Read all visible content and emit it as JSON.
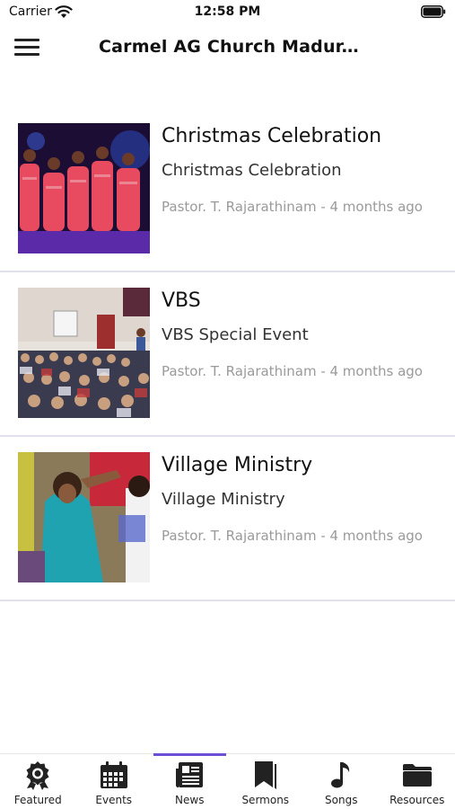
{
  "status_bar": {
    "carrier": "Carrier",
    "time": "12:58 PM"
  },
  "header": {
    "title": "Carmel AG Church Madur..."
  },
  "news": [
    {
      "title": "Christmas Celebration",
      "subtitle": "Christmas Celebration",
      "meta": "Pastor. T. Rajarathinam - 4 months ago"
    },
    {
      "title": "VBS",
      "subtitle": "VBS Special Event",
      "meta": "Pastor. T. Rajarathinam - 4 months ago"
    },
    {
      "title": "Village Ministry",
      "subtitle": "Village Ministry",
      "meta": "Pastor. T. Rajarathinam - 4 months ago"
    }
  ],
  "tabs": [
    {
      "label": "Featured",
      "icon": "award-icon"
    },
    {
      "label": "Events",
      "icon": "calendar-icon"
    },
    {
      "label": "News",
      "icon": "newspaper-icon",
      "active": true
    },
    {
      "label": "Sermons",
      "icon": "bookmark-icon"
    },
    {
      "label": "Songs",
      "icon": "music-note-icon"
    },
    {
      "label": "Resources",
      "icon": "folder-icon"
    }
  ],
  "colors": {
    "accent": "#6c4fd6",
    "divider": "#e0e0ee",
    "meta_text": "#9a9a9a"
  }
}
